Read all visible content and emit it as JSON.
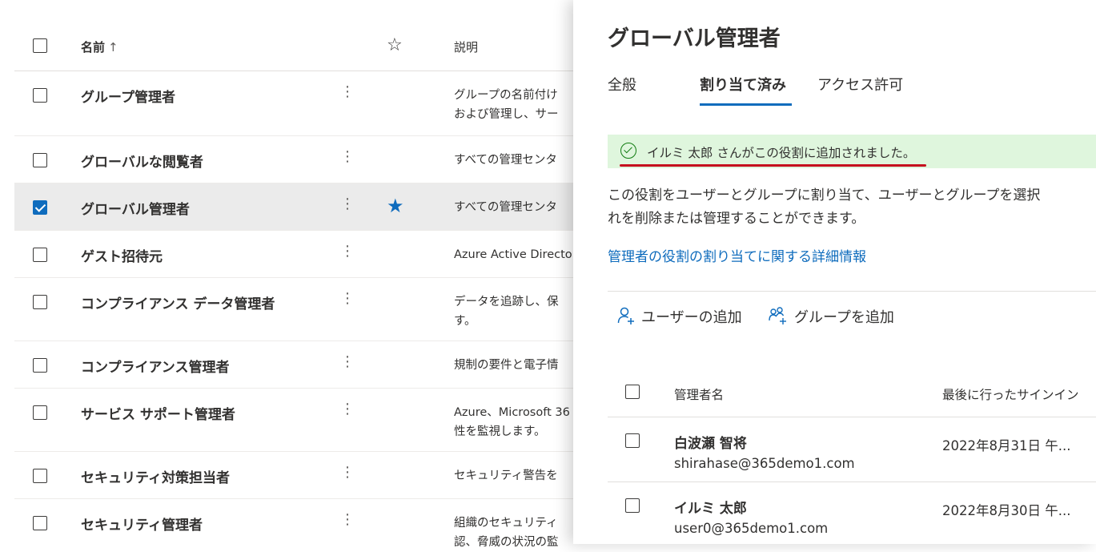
{
  "list": {
    "header": {
      "name": "名前",
      "sort_arrow": "↑",
      "star": "☆",
      "description": "説明"
    },
    "rows": [
      {
        "name": "グループ管理者",
        "more": "⋮",
        "desc": [
          "グループの名前付け",
          "および管理し、サー"
        ],
        "favorite": false,
        "checked": false
      },
      {
        "name": "グローバルな閲覧者",
        "more": "⋮",
        "desc": [
          "すべての管理センタ"
        ],
        "favorite": false,
        "checked": false
      },
      {
        "name": "グローバル管理者",
        "more": "⋮",
        "desc": [
          "すべての管理センタ"
        ],
        "favorite": true,
        "checked": true
      },
      {
        "name": "ゲスト招待元",
        "more": "⋮",
        "desc": [
          "Azure Active Directo"
        ],
        "favorite": false,
        "checked": false
      },
      {
        "name": "コンプライアンス データ管理者",
        "more": "⋮",
        "desc": [
          "データを追跡し、保",
          "す。"
        ],
        "favorite": false,
        "checked": false
      },
      {
        "name": "コンプライアンス管理者",
        "more": "⋮",
        "desc": [
          "規制の要件と電子情"
        ],
        "favorite": false,
        "checked": false
      },
      {
        "name": "サービス サポート管理者",
        "more": "⋮",
        "desc": [
          "Azure、Microsoft 36",
          "性を監視します。"
        ],
        "favorite": false,
        "checked": false
      },
      {
        "name": "セキュリティ対策担当者",
        "more": "⋮",
        "desc": [
          "セキュリティ警告を"
        ],
        "favorite": false,
        "checked": false
      },
      {
        "name": "セキュリティ管理者",
        "more": "⋮",
        "desc": [
          "組織のセキュリティ",
          "認、脅威の状況の監"
        ],
        "favorite": false,
        "checked": false
      }
    ],
    "star_filled": "★"
  },
  "panel": {
    "title": "グローバル管理者",
    "tabs": [
      {
        "label": "全般",
        "active": false
      },
      {
        "label": "割り当て済み",
        "active": true
      },
      {
        "label": "アクセス許可",
        "active": false
      }
    ],
    "banner": {
      "text": "イルミ 太郎 さんがこの役割に追加されました。",
      "icon": "check-circle-icon"
    },
    "description": "この役割をユーザーとグループに割り当て、ユーザーとグループを選択\nれを削除または管理することができます。",
    "link": "管理者の役割の割り当てに関する詳細情報",
    "commands": {
      "add_user": "ユーザーの追加",
      "add_group": "グループを追加"
    },
    "table": {
      "col_name": "管理者名",
      "col_signin": "最後に行ったサインイン",
      "rows": [
        {
          "name": "白波瀬 智将",
          "email": "shirahase@365demo1.com",
          "signin": "2022年8月31日 午..."
        },
        {
          "name": "イルミ 太郎",
          "email": "user0@365demo1.com",
          "signin": "2022年8月30日 午..."
        }
      ]
    }
  },
  "colors": {
    "accent": "#0f6cbd",
    "success_bg": "#dff6dd",
    "success_icon": "#107c10",
    "annotation": "#c50f1f",
    "selected_row": "#ebebeb"
  }
}
